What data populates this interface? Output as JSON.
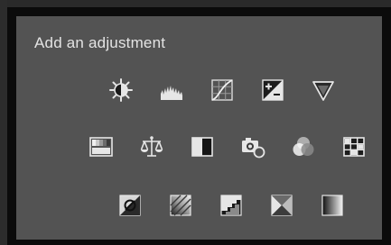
{
  "panel": {
    "title": "Add an adjustment"
  },
  "rows": [
    {
      "icons": [
        {
          "name": "brightness-contrast-icon",
          "label": "Brightness/Contrast"
        },
        {
          "name": "levels-icon",
          "label": "Levels"
        },
        {
          "name": "curves-icon",
          "label": "Curves"
        },
        {
          "name": "exposure-icon",
          "label": "Exposure"
        },
        {
          "name": "vibrance-icon",
          "label": "Vibrance"
        }
      ]
    },
    {
      "icons": [
        {
          "name": "hue-saturation-icon",
          "label": "Hue/Saturation"
        },
        {
          "name": "color-balance-icon",
          "label": "Color Balance"
        },
        {
          "name": "black-white-icon",
          "label": "Black & White"
        },
        {
          "name": "photo-filter-icon",
          "label": "Photo Filter"
        },
        {
          "name": "channel-mixer-icon",
          "label": "Channel Mixer"
        },
        {
          "name": "color-lookup-icon",
          "label": "Color Lookup"
        }
      ]
    },
    {
      "icons": [
        {
          "name": "invert-icon",
          "label": "Invert"
        },
        {
          "name": "posterize-icon",
          "label": "Posterize"
        },
        {
          "name": "threshold-icon",
          "label": "Threshold"
        },
        {
          "name": "selective-color-icon",
          "label": "Selective Color"
        },
        {
          "name": "gradient-map-icon",
          "label": "Gradient Map"
        }
      ]
    }
  ]
}
